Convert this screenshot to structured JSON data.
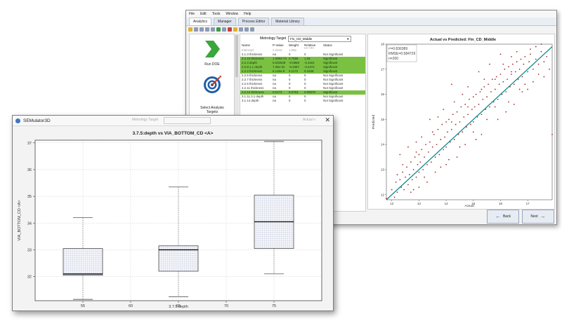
{
  "back_window": {
    "menu": [
      "File",
      "Edit",
      "Tools",
      "Window",
      "Help"
    ],
    "tabs": [
      {
        "label": "Analytics",
        "active": true
      },
      {
        "label": "Manager",
        "active": false
      },
      {
        "label": "Process Editor",
        "active": false
      },
      {
        "label": "Material Library",
        "active": false
      }
    ],
    "steps": [
      {
        "label": "Run DOE",
        "icon": "chevron-right-icon"
      },
      {
        "label": "Select Analysis Targets",
        "icon": "target-icon"
      }
    ],
    "metrology_label": "Metrology Target",
    "metrology_value": "Fin_CD_Middle",
    "table_headers": [
      "Name",
      "P-Value",
      "Weight",
      "Relative Weight",
      "Status"
    ],
    "table_rows": [
      {
        "name": "Intercept",
        "p": "2.2418",
        "w": "1.082",
        "rw": "",
        "status": "",
        "style": "dim"
      },
      {
        "name": "2.1.3 thickness",
        "p": "na",
        "w": "0",
        "rw": "0",
        "status": "Not Significant",
        "style": ""
      },
      {
        "name": "2.2.10 thickness",
        "p": "1.0994-73",
        "w": "0.7596",
        "rw": "1.25",
        "status": "Significant",
        "style": "sig"
      },
      {
        "name": "2.2.4 depth",
        "p": "0.002639",
        "w": "-0.0868",
        "rw": "-0.1181",
        "status": "Significant",
        "style": "sig"
      },
      {
        "name": "2.2.8.1.1 depth",
        "p": "7.25e-31",
        "w": "-0.3467",
        "rw": "-0.4471",
        "status": "Significant",
        "style": "sig"
      },
      {
        "name": "2.2.2 thickness",
        "p": "6.148e-8",
        "w": "0.1172",
        "rw": "0.1638",
        "status": "Significant",
        "style": "sig"
      },
      {
        "name": "2.2.5 thickness",
        "p": "na",
        "w": "0",
        "rw": "0",
        "status": "Not Significant",
        "style": ""
      },
      {
        "name": "2.2.7 thickness",
        "p": "na",
        "w": "0",
        "rw": "0",
        "status": "Not Significant",
        "style": ""
      },
      {
        "name": "2.2.6 thickness",
        "p": "na",
        "w": "0",
        "rw": "0",
        "status": "Not Significant",
        "style": ""
      },
      {
        "name": "2.2.11 thickness",
        "p": "na",
        "w": "0",
        "rw": "0",
        "status": "Not Significant",
        "style": ""
      },
      {
        "name": "2.2.12 thickness",
        "p": "0.0172",
        "w": "0.0763",
        "rw": "0.06978",
        "status": "Significant",
        "style": "sig"
      },
      {
        "name": "3.1.11.3.1 depth",
        "p": "na",
        "w": "0",
        "rw": "0",
        "status": "Not Significant",
        "style": ""
      },
      {
        "name": "3.1.14 depth",
        "p": "na",
        "w": "0",
        "rw": "0",
        "status": "Not Significant",
        "style": ""
      }
    ],
    "buttons": {
      "back": "Back",
      "next": "Next"
    },
    "chart_data": {
      "type": "scatter",
      "title": "Actual vs Predicted: Fin_CD_Middle",
      "xlabel": "Actual",
      "ylabel": "Predicted",
      "xlim": [
        11.8,
        17.9
      ],
      "ylim": [
        11.8,
        18.0
      ],
      "xticks": [
        12,
        13,
        14,
        15,
        16,
        17
      ],
      "yticks": [
        12,
        13,
        14,
        15,
        16,
        17,
        18
      ],
      "annotations": [
        "r²=0.836389",
        "RMSE=0.584729",
        "n=200"
      ],
      "fit_line": [
        [
          11.8,
          11.8
        ],
        [
          17.9,
          17.9
        ]
      ],
      "points": [
        [
          11.8,
          11.85
        ],
        [
          12.0,
          12.2
        ],
        [
          12.1,
          11.9
        ],
        [
          12.15,
          12.5
        ],
        [
          12.2,
          12.1
        ],
        [
          12.3,
          12.6
        ],
        [
          12.35,
          12.3
        ],
        [
          12.4,
          12.9
        ],
        [
          12.45,
          12.2
        ],
        [
          12.5,
          12.7
        ],
        [
          12.55,
          13.1
        ],
        [
          12.6,
          12.4
        ],
        [
          12.65,
          12.8
        ],
        [
          12.7,
          13.3
        ],
        [
          12.75,
          12.6
        ],
        [
          12.8,
          13.0
        ],
        [
          12.85,
          13.5
        ],
        [
          12.9,
          12.7
        ],
        [
          12.95,
          13.2
        ],
        [
          13.0,
          13.6
        ],
        [
          13.0,
          12.9
        ],
        [
          13.05,
          13.3
        ],
        [
          13.1,
          13.8
        ],
        [
          13.15,
          13.0
        ],
        [
          13.2,
          13.5
        ],
        [
          13.25,
          14.0
        ],
        [
          13.3,
          13.2
        ],
        [
          13.35,
          13.7
        ],
        [
          13.4,
          14.1
        ],
        [
          13.45,
          13.3
        ],
        [
          13.5,
          13.9
        ],
        [
          13.55,
          14.4
        ],
        [
          13.6,
          13.5
        ],
        [
          13.65,
          14.0
        ],
        [
          13.7,
          14.6
        ],
        [
          13.75,
          13.6
        ],
        [
          13.8,
          14.2
        ],
        [
          13.85,
          14.8
        ],
        [
          13.9,
          13.8
        ],
        [
          13.95,
          14.3
        ],
        [
          14.0,
          14.9
        ],
        [
          14.0,
          13.9
        ],
        [
          14.05,
          14.5
        ],
        [
          14.1,
          15.0
        ],
        [
          14.15,
          14.1
        ],
        [
          14.2,
          14.6
        ],
        [
          14.25,
          15.2
        ],
        [
          14.3,
          14.2
        ],
        [
          14.35,
          14.8
        ],
        [
          14.4,
          15.3
        ],
        [
          14.45,
          14.4
        ],
        [
          14.5,
          14.9
        ],
        [
          14.55,
          15.5
        ],
        [
          14.6,
          14.5
        ],
        [
          14.65,
          15.1
        ],
        [
          14.7,
          15.6
        ],
        [
          14.75,
          14.7
        ],
        [
          14.8,
          15.2
        ],
        [
          14.85,
          15.8
        ],
        [
          14.9,
          14.8
        ],
        [
          14.95,
          15.4
        ],
        [
          15.0,
          15.9
        ],
        [
          15.0,
          14.9
        ],
        [
          15.05,
          15.5
        ],
        [
          15.1,
          16.0
        ],
        [
          15.15,
          15.1
        ],
        [
          15.2,
          15.6
        ],
        [
          15.25,
          16.1
        ],
        [
          15.3,
          15.2
        ],
        [
          15.35,
          15.8
        ],
        [
          15.4,
          16.3
        ],
        [
          15.45,
          15.4
        ],
        [
          15.5,
          15.9
        ],
        [
          15.55,
          16.4
        ],
        [
          15.6,
          15.5
        ],
        [
          15.65,
          16.1
        ],
        [
          15.7,
          16.6
        ],
        [
          15.75,
          15.7
        ],
        [
          15.8,
          16.2
        ],
        [
          15.85,
          16.7
        ],
        [
          15.9,
          15.8
        ],
        [
          15.95,
          16.4
        ],
        [
          16.0,
          16.8
        ],
        [
          16.05,
          16.0
        ],
        [
          16.1,
          16.5
        ],
        [
          16.15,
          17.0
        ],
        [
          16.2,
          16.1
        ],
        [
          16.25,
          16.6
        ],
        [
          16.3,
          17.1
        ],
        [
          16.35,
          16.3
        ],
        [
          16.4,
          16.8
        ],
        [
          16.45,
          17.2
        ],
        [
          16.5,
          16.4
        ],
        [
          16.55,
          16.9
        ],
        [
          16.6,
          17.3
        ],
        [
          16.65,
          16.6
        ],
        [
          16.7,
          17.0
        ],
        [
          16.75,
          17.4
        ],
        [
          16.8,
          16.7
        ],
        [
          16.85,
          17.2
        ],
        [
          16.9,
          17.5
        ],
        [
          17.0,
          16.9
        ],
        [
          17.05,
          17.3
        ],
        [
          17.1,
          17.6
        ],
        [
          17.2,
          17.0
        ],
        [
          17.3,
          17.4
        ],
        [
          17.4,
          17.2
        ],
        [
          17.5,
          17.7
        ],
        [
          17.6,
          17.3
        ],
        [
          17.7,
          17.5
        ],
        [
          12.3,
          13.6
        ],
        [
          12.9,
          14.1
        ],
        [
          13.4,
          15.0
        ],
        [
          13.9,
          15.4
        ],
        [
          14.2,
          16.4
        ],
        [
          14.6,
          16.0
        ],
        [
          15.2,
          16.9
        ],
        [
          15.6,
          17.2
        ],
        [
          16.0,
          17.6
        ],
        [
          16.4,
          16.9
        ],
        [
          13.0,
          12.3
        ],
        [
          13.6,
          12.9
        ],
        [
          14.1,
          13.4
        ],
        [
          14.7,
          14.0
        ],
        [
          15.3,
          14.4
        ],
        [
          15.9,
          15.0
        ],
        [
          16.5,
          15.6
        ],
        [
          17.0,
          16.2
        ],
        [
          17.6,
          16.7
        ],
        [
          17.9,
          14.4
        ],
        [
          14.4,
          13.5
        ],
        [
          15.1,
          14.2
        ],
        [
          15.8,
          15.5
        ],
        [
          16.2,
          15.3
        ],
        [
          16.8,
          16.1
        ],
        [
          14.0,
          13.2
        ],
        [
          13.3,
          12.5
        ],
        [
          12.7,
          12.1
        ],
        [
          17.2,
          16.5
        ],
        [
          17.8,
          17.0
        ],
        [
          12.6,
          13.9
        ],
        [
          13.1,
          14.3
        ],
        [
          13.7,
          15.1
        ],
        [
          14.3,
          15.7
        ],
        [
          14.8,
          16.3
        ],
        [
          15.4,
          16.6
        ],
        [
          16.1,
          17.2
        ],
        [
          16.6,
          17.7
        ],
        [
          17.1,
          17.8
        ],
        [
          17.5,
          18.0
        ],
        [
          12.2,
          12.8
        ],
        [
          12.8,
          12.2
        ],
        [
          13.2,
          12.7
        ],
        [
          13.8,
          13.1
        ],
        [
          14.5,
          13.9
        ],
        [
          15.0,
          14.5
        ],
        [
          15.5,
          15.0
        ],
        [
          16.3,
          15.7
        ],
        [
          16.9,
          16.4
        ],
        [
          17.4,
          16.8
        ],
        [
          14.2,
          14.9
        ],
        [
          14.8,
          15.5
        ],
        [
          15.3,
          16.2
        ],
        [
          15.8,
          16.6
        ],
        [
          16.4,
          17.5
        ],
        [
          13.5,
          14.5
        ],
        [
          12.9,
          13.7
        ],
        [
          12.4,
          13.2
        ],
        [
          16.7,
          16.2
        ],
        [
          17.3,
          17.9
        ]
      ]
    }
  },
  "front_window": {
    "title": "SEMulator3D",
    "ghost_metrology": "Metrology Target",
    "ghost_right": "Actual v",
    "chart_data": {
      "type": "box",
      "title": "3.7.5:depth vs VIA_BOTTOM_CD <A>",
      "xlabel": "3.7.5:depth",
      "ylabel": "VIA_BOTTOM_CD <A>",
      "xlim": [
        50,
        80
      ],
      "ylim": [
        31.1,
        37.1
      ],
      "xticks": [
        55,
        60,
        65,
        70,
        75
      ],
      "yticks": [
        32,
        33,
        34,
        35,
        36,
        37
      ],
      "boxes": [
        {
          "x": 55,
          "min": 31.15,
          "q1": 32.05,
          "median": 32.1,
          "q3": 33.05,
          "max": 34.2
        },
        {
          "x": 65,
          "min": 31.25,
          "q1": 32.2,
          "median": 33.0,
          "q3": 33.15,
          "max": 35.35
        },
        {
          "x": 75,
          "min": 32.1,
          "q1": 33.05,
          "median": 34.05,
          "q3": 35.05,
          "max": 37.05
        }
      ]
    }
  }
}
